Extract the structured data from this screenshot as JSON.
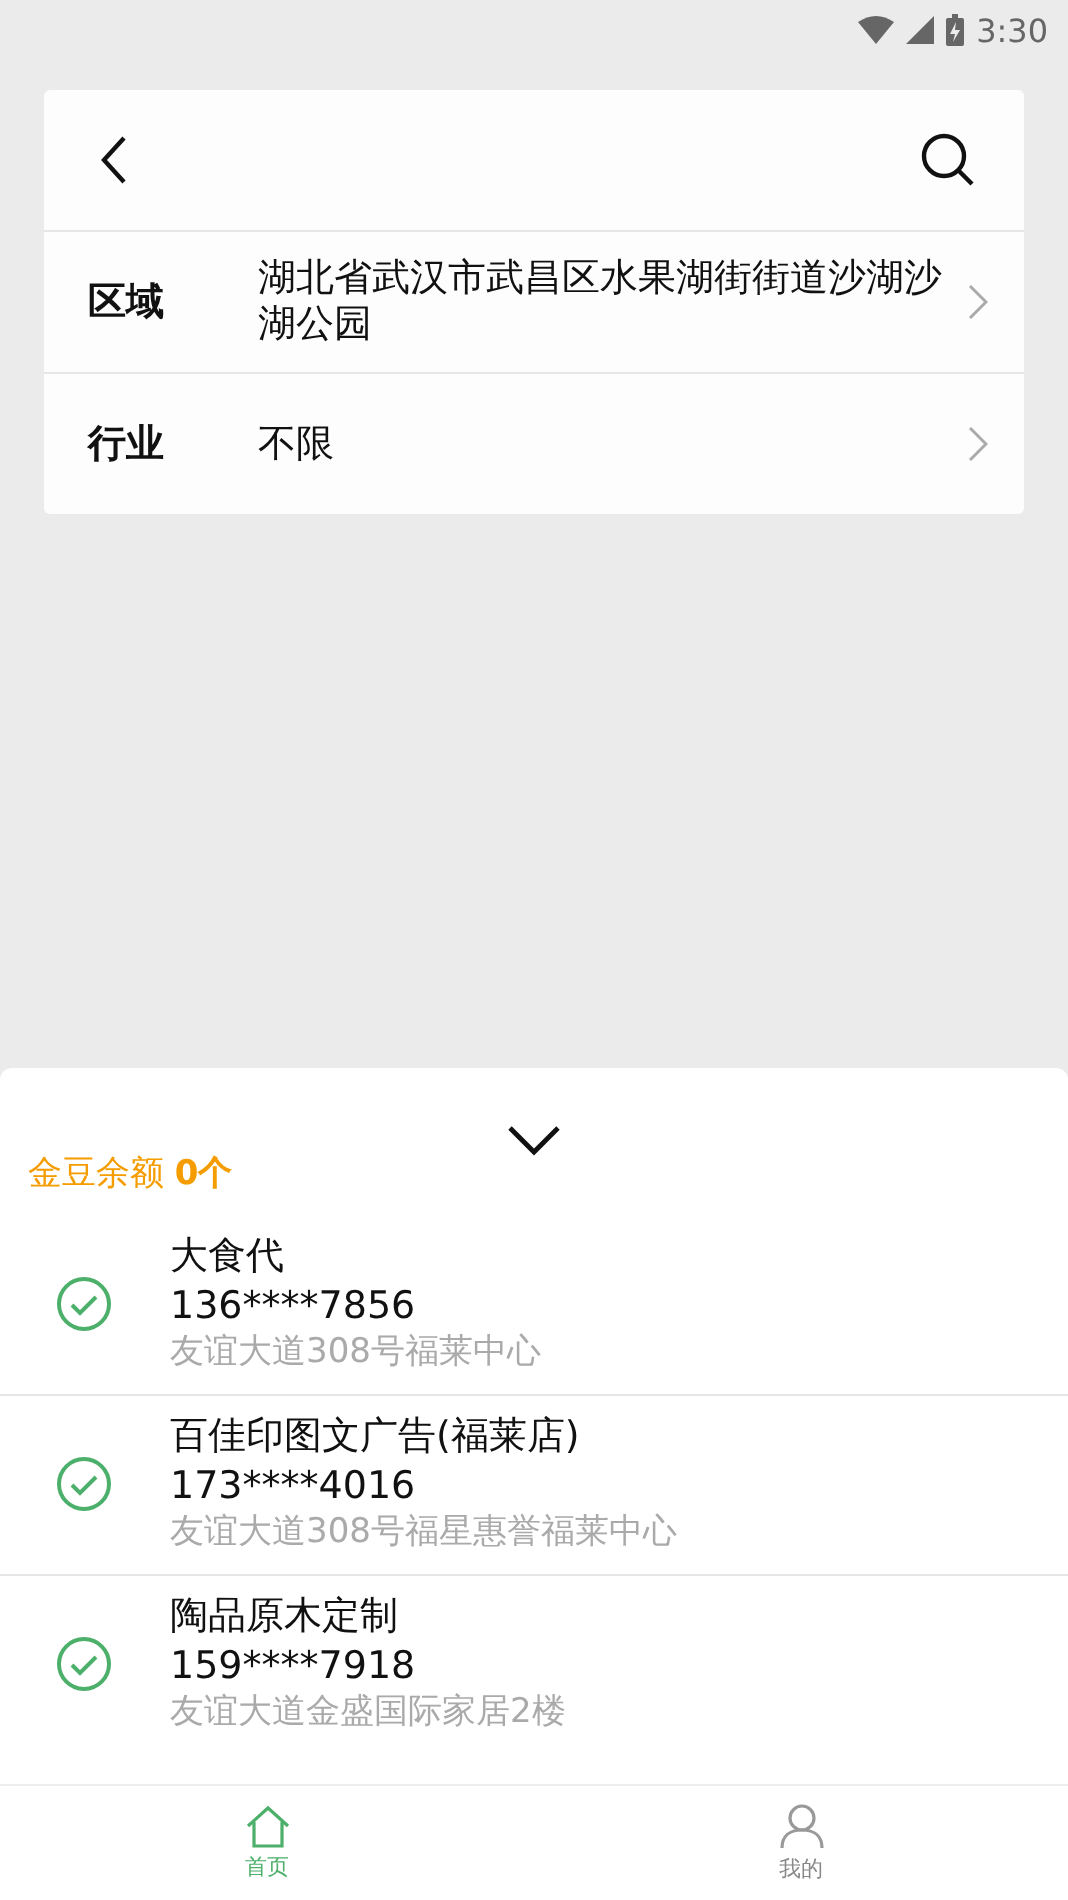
{
  "status_bar": {
    "time": "3:30"
  },
  "filters": [
    {
      "label": "区域",
      "value": "湖北省武汉市武昌区水果湖街街道沙湖沙湖公园"
    },
    {
      "label": "行业",
      "value": "不限"
    }
  ],
  "sheet": {
    "balance": "金豆余额 **0个**",
    "shops": [
      {
        "name": "大食代",
        "phone": "136****7856",
        "address": "友谊大道308号福莱中心"
      },
      {
        "name": "百佳印图文广告(福莱店)",
        "phone": "173****4016",
        "address": "友谊大道308号福星惠誉福莱中心"
      },
      {
        "name": "陶品原木定制",
        "phone": "159****7918",
        "address": "友谊大道金盛国际家居2楼"
      }
    ]
  },
  "tabs": [
    {
      "label": "首页",
      "kind": "home",
      "selected": true
    },
    {
      "label": "我的",
      "kind": "profile",
      "selected": false
    }
  ]
}
